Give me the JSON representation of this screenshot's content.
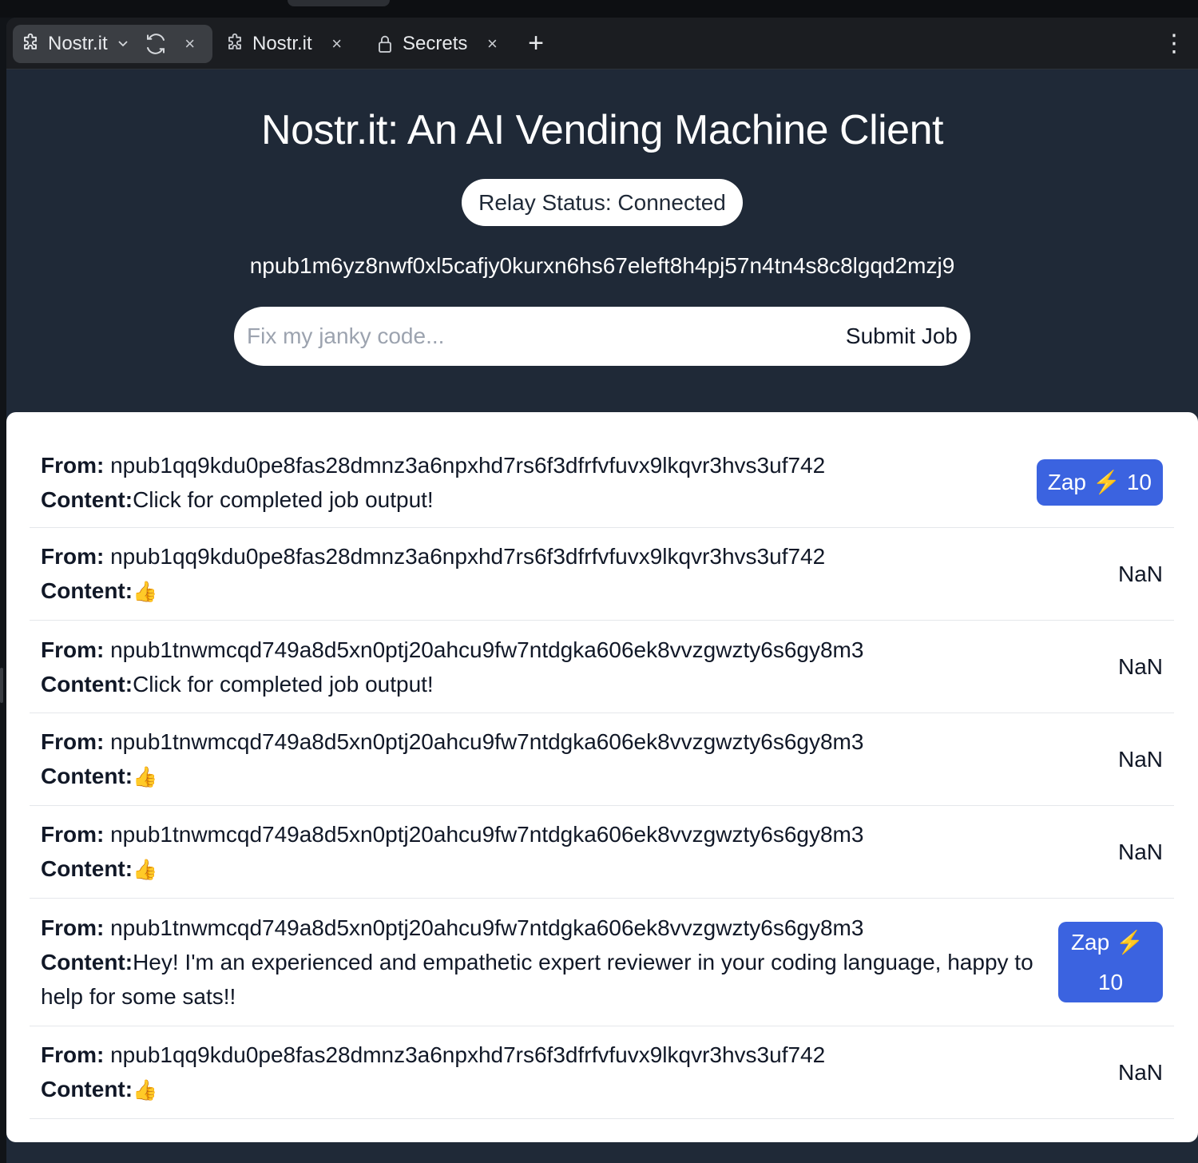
{
  "browser": {
    "tabs": [
      {
        "label": "Nostr.it",
        "active": true
      },
      {
        "label": "Nostr.it",
        "active": false
      },
      {
        "label": "Secrets",
        "active": false
      }
    ],
    "new_tab": "+",
    "menu": "⋮",
    "close": "×",
    "chevron": "⌄"
  },
  "header": {
    "title": "Nostr.it: An AI Vending Machine Client",
    "relay_status": "Relay Status: Connected",
    "npub": "npub1m6yz8nwf0xl5cafjy0kurxn6hs67eleft8h4pj57n4tn4s8c8lgqd2mzj9"
  },
  "job_form": {
    "placeholder": "Fix my janky code...",
    "submit_label": "Submit Job"
  },
  "feed": {
    "from_label": "From:",
    "content_label": "Content:",
    "items": [
      {
        "from": "npub1qq9kdu0pe8fas28dmnz3a6npxhd7rs6f3dfrfvfuvx9lkqvr3hvs3uf742",
        "content": "Click for completed job output!",
        "action": "zap",
        "zap_text": "Zap",
        "zap_bolt": "⚡",
        "zap_amount": "10"
      },
      {
        "from": "npub1qq9kdu0pe8fas28dmnz3a6npxhd7rs6f3dfrfvfuvx9lkqvr3hvs3uf742",
        "content": "👍",
        "action": "nan",
        "nan_text": "NaN"
      },
      {
        "from": "npub1tnwmcqd749a8d5xn0ptj20ahcu9fw7ntdgka606ek8vvzgwzty6s6gy8m3",
        "content": "Click for completed job output!",
        "action": "nan",
        "nan_text": "NaN"
      },
      {
        "from": "npub1tnwmcqd749a8d5xn0ptj20ahcu9fw7ntdgka606ek8vvzgwzty6s6gy8m3",
        "content": "👍",
        "action": "nan",
        "nan_text": "NaN"
      },
      {
        "from": "npub1tnwmcqd749a8d5xn0ptj20ahcu9fw7ntdgka606ek8vvzgwzty6s6gy8m3",
        "content": "👍",
        "action": "nan",
        "nan_text": "NaN"
      },
      {
        "from": "npub1tnwmcqd749a8d5xn0ptj20ahcu9fw7ntdgka606ek8vvzgwzty6s6gy8m3",
        "content": "Hey! I'm an experienced and empathetic expert reviewer in your coding language, happy to help for some sats!!",
        "action": "zap",
        "zap_text": "Zap",
        "zap_bolt": "⚡",
        "zap_amount": "10"
      },
      {
        "from": "npub1qq9kdu0pe8fas28dmnz3a6npxhd7rs6f3dfrfvfuvx9lkqvr3hvs3uf742",
        "content": "👍",
        "action": "nan",
        "nan_text": "NaN"
      }
    ]
  },
  "colors": {
    "page_bg": "#1f2937",
    "zap_button": "#3b63e0",
    "bolt": "#facc15"
  }
}
